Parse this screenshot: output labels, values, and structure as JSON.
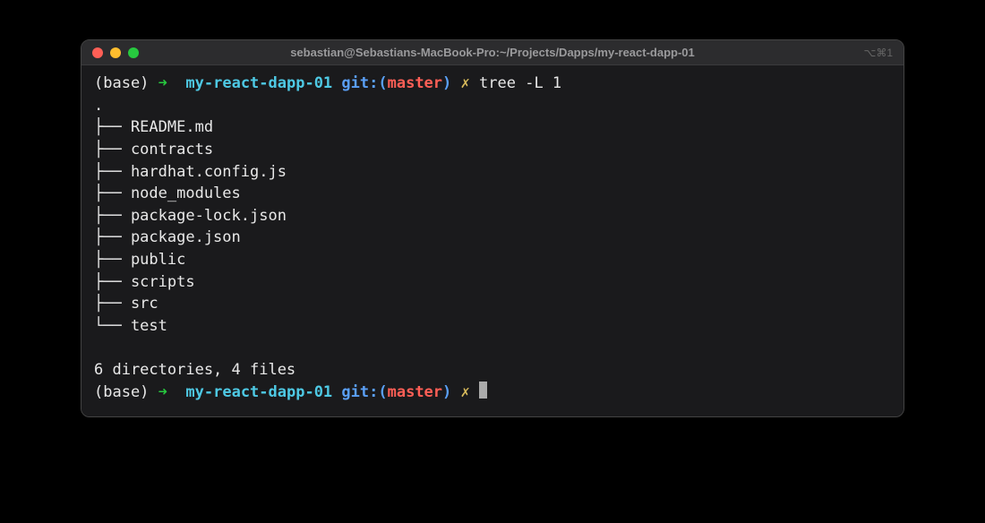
{
  "window": {
    "title": "sebastian@Sebastians-MacBook-Pro:~/Projects/Dapps/my-react-dapp-01",
    "shortcut_hint": "⌥⌘1"
  },
  "prompt1": {
    "env": "(base)",
    "arrow": "➜",
    "dir": "my-react-dapp-01",
    "git_label": "git:(",
    "branch": "master",
    "git_close": ")",
    "dirty": "✗",
    "command": "tree -L 1"
  },
  "tree": {
    "root": ".",
    "lines": [
      "├── README.md",
      "├── contracts",
      "├── hardhat.config.js",
      "├── node_modules",
      "├── package-lock.json",
      "├── package.json",
      "├── public",
      "├── scripts",
      "├── src",
      "└── test"
    ],
    "summary": "6 directories, 4 files"
  },
  "prompt2": {
    "env": "(base)",
    "arrow": "➜",
    "dir": "my-react-dapp-01",
    "git_label": "git:(",
    "branch": "master",
    "git_close": ")",
    "dirty": "✗"
  }
}
